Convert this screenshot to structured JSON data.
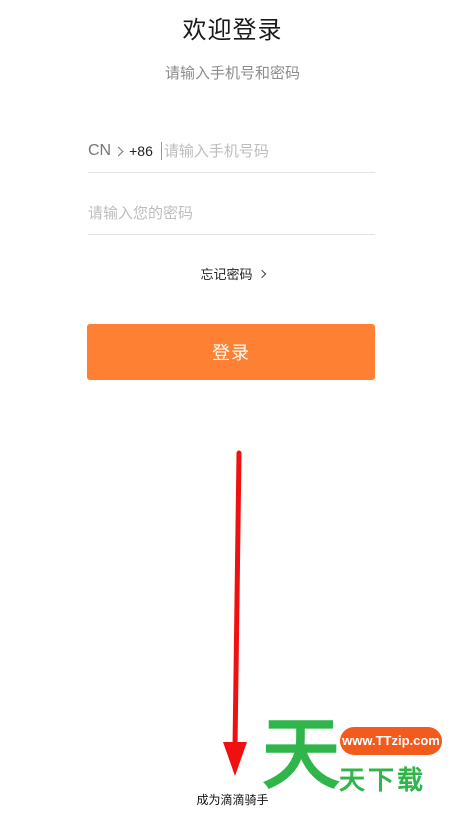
{
  "header": {
    "title": "欢迎登录",
    "subtitle": "请输入手机号和密码"
  },
  "phone": {
    "country": "CN",
    "code": "+86",
    "placeholder": "请输入手机号码"
  },
  "password": {
    "placeholder": "请输入您的密码"
  },
  "forgot_label": "忘记密码",
  "login_label": "登录",
  "rider_link": "成为滴滴骑手",
  "watermark": {
    "badge": "www.TTzip.com",
    "big_char": "天",
    "text": "天下载"
  },
  "colors": {
    "accent": "#fe8133",
    "annotation_arrow": "#f01010",
    "watermark_green": "#2fb54a"
  }
}
